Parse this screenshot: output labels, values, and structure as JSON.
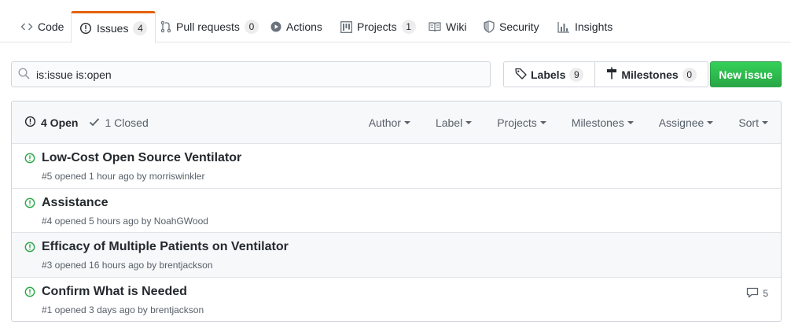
{
  "tabs": [
    {
      "label": "Code",
      "icon": "code-icon"
    },
    {
      "label": "Issues",
      "count": "4",
      "icon": "issue-opened-icon",
      "active": true
    },
    {
      "label": "Pull requests",
      "count": "0",
      "icon": "git-pull-request-icon"
    },
    {
      "label": "Actions",
      "icon": "play-icon"
    },
    {
      "label": "Projects",
      "count": "1",
      "icon": "project-icon"
    },
    {
      "label": "Wiki",
      "icon": "book-icon"
    },
    {
      "label": "Security",
      "icon": "shield-icon"
    },
    {
      "label": "Insights",
      "icon": "graph-icon"
    }
  ],
  "search": {
    "value": "is:issue is:open"
  },
  "labels_button": {
    "label": "Labels",
    "count": "9"
  },
  "milestones_button": {
    "label": "Milestones",
    "count": "0"
  },
  "new_issue_button": {
    "label": "New issue"
  },
  "header": {
    "open_label": "4 Open",
    "closed_label": "1 Closed",
    "filters": [
      "Author",
      "Label",
      "Projects",
      "Milestones",
      "Assignee",
      "Sort"
    ]
  },
  "issues": [
    {
      "title": "Low-Cost Open Source Ventilator",
      "meta": "#5 opened 1 hour ago by morriswinkler",
      "comments": ""
    },
    {
      "title": "Assistance",
      "meta": "#4 opened 5 hours ago by NoahGWood",
      "comments": ""
    },
    {
      "title": "Efficacy of Multiple Patients on Ventilator",
      "meta": "#3 opened 16 hours ago by brentjackson",
      "comments": ""
    },
    {
      "title": "Confirm What is Needed",
      "meta": "#1 opened 3 days ago by brentjackson",
      "comments": "5"
    }
  ],
  "colors": {
    "accent_tab": "#e36209",
    "open_green": "#28a745",
    "button_green": "#2ea44f"
  }
}
